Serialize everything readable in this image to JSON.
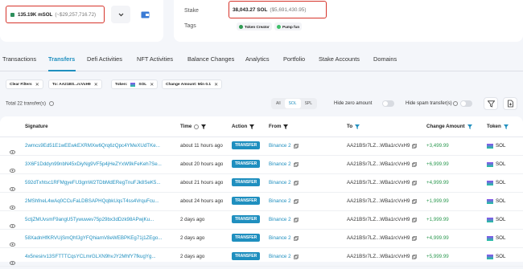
{
  "account": {
    "balance_label": "135.19K mSOL",
    "balance_usd": "(~$29,257,716.72)",
    "stake_label": "Stake",
    "stake_value": "38,043.27 SOL",
    "stake_usd": "($5,691,430.95)",
    "tags_label": "Tags",
    "tags": [
      "Token Creator",
      "Pump fun"
    ]
  },
  "tabs": [
    "Transactions",
    "Transfers",
    "Defi Activities",
    "NFT Activities",
    "Balance Changes",
    "Analytics",
    "Portfolio",
    "Stake Accounts",
    "Domains"
  ],
  "active_tab": "Transfers",
  "filters": {
    "clear_label": "Clear Filters",
    "to_chip": "To: AA21BS...rcVxH9",
    "token_chip_prefix": "Token:",
    "token_chip_value": "SOL",
    "amount_chip": "Change Amount: Min 0.1"
  },
  "toolbar": {
    "total_text": "Total 22 transfer(s)",
    "seg_all": "All",
    "seg_sol": "SOL",
    "seg_spl": "SPL",
    "hide_zero": "Hide zero amount",
    "hide_spam": "Hide spam transfer(s)"
  },
  "table": {
    "headers": {
      "signature": "Signature",
      "time": "Time",
      "action": "Action",
      "from": "From",
      "to": "To",
      "change_amount": "Change Amount",
      "token": "Token"
    },
    "rows": [
      {
        "sig": "2wmcs9Ed51E1wEEwkEXRMXw6Qrq6zQpc4YMeXUdTKe...",
        "time": "about 11 hours ago",
        "action": "TRANSFER",
        "from": "Binance 2",
        "to": "AA21BSr7LZ...WBa1rcVxH9",
        "amount": "+3,499.99",
        "token": "SOL"
      },
      {
        "sig": "3X6F1Dddyn99nbN45xDiyNg9VF5p4jHeZYxW9kFeKeh7Se...",
        "time": "about 20 hours ago",
        "action": "TRANSFER",
        "from": "Binance 2",
        "to": "AA21BSr7LZ...WBa1rcVxH9",
        "amount": "+6,999.99",
        "token": "SOL"
      },
      {
        "sig": "592dTxhtsc1RFMgyeFU3gmW2TDbMdERegTnuFJk8SeK5...",
        "time": "about 21 hours ago",
        "action": "TRANSFER",
        "from": "Binance 2",
        "to": "AA21BSr7LZ...WBa1rcVxH9",
        "amount": "+4,999.99",
        "token": "SOL"
      },
      {
        "sig": "2MShfneL4wAq0CCuFaLDBSAPHQqbkUqsT4ss4VrquFcu...",
        "time": "about 24 hours ago",
        "action": "TRANSFER",
        "from": "Binance 2",
        "to": "AA21BSr7LZ...WBa1rcVxH9",
        "amount": "+1,999.99",
        "token": "SOL"
      },
      {
        "sig": "5ctjZMUvsmF9angU5Tywuwev75p29bx3dDzk98APwjKu...",
        "time": "2 days ago",
        "action": "TRANSFER",
        "from": "Binance 2",
        "to": "AA21BSr7LZ...WBa1rcVxH9",
        "amount": "+1,999.99",
        "token": "SOL"
      },
      {
        "sig": "58XadnHfKRVUjSmQhfJgYFQhiamV8eWEBPKEg71j1ZEgo...",
        "time": "2 days ago",
        "action": "TRANSFER",
        "from": "Binance 2",
        "to": "AA21BSr7LZ...WBa1rcVxH9",
        "amount": "+4,999.99",
        "token": "SOL"
      },
      {
        "sig": "4x5nesirv13SFTTTCqsYCLmrGLXN9hvJY2MhfY7fkugYg...",
        "time": "2 days ago",
        "action": "TRANSFER",
        "from": "Binance 2",
        "to": "AA21BSr7LZ...WBa1rcVxH9",
        "amount": "+5,999.99",
        "token": "SOL"
      }
    ]
  },
  "colors": {
    "accent": "#1f8fbf",
    "highlight_border": "#d6342b",
    "positive": "#2e9a52"
  }
}
